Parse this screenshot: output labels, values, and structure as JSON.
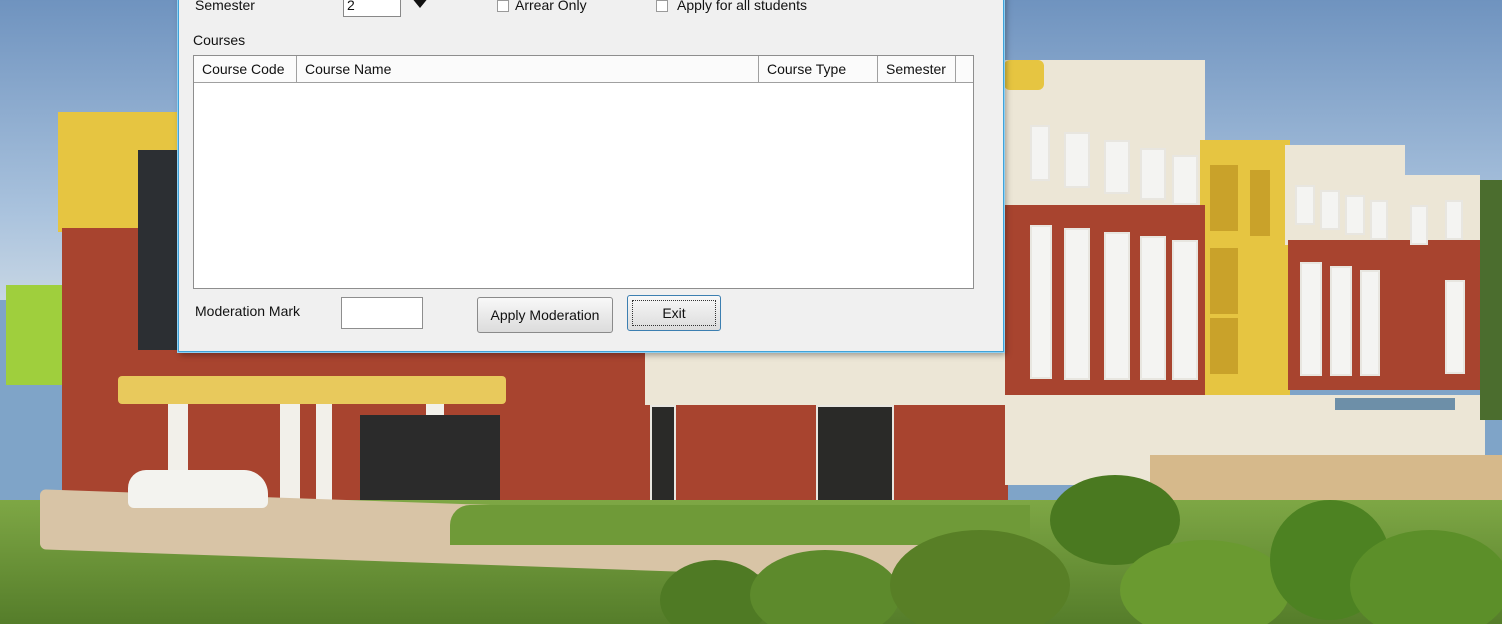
{
  "form": {
    "semester_label": "Semester",
    "semester_value": "2",
    "arrear_only_label": "Arrear Only",
    "arrear_only_checked": false,
    "apply_all_label": "Apply for all students",
    "apply_all_checked": false,
    "courses_label": "Courses",
    "moderation_label": "Moderation Mark",
    "moderation_value": ""
  },
  "table": {
    "columns": [
      "Course Code",
      "Course Name",
      "Course Type",
      "Semester"
    ],
    "rows": []
  },
  "buttons": {
    "apply_moderation": "Apply Moderation",
    "exit": "Exit"
  },
  "icons": {
    "semester_dropdown": "triangle-down-icon"
  }
}
